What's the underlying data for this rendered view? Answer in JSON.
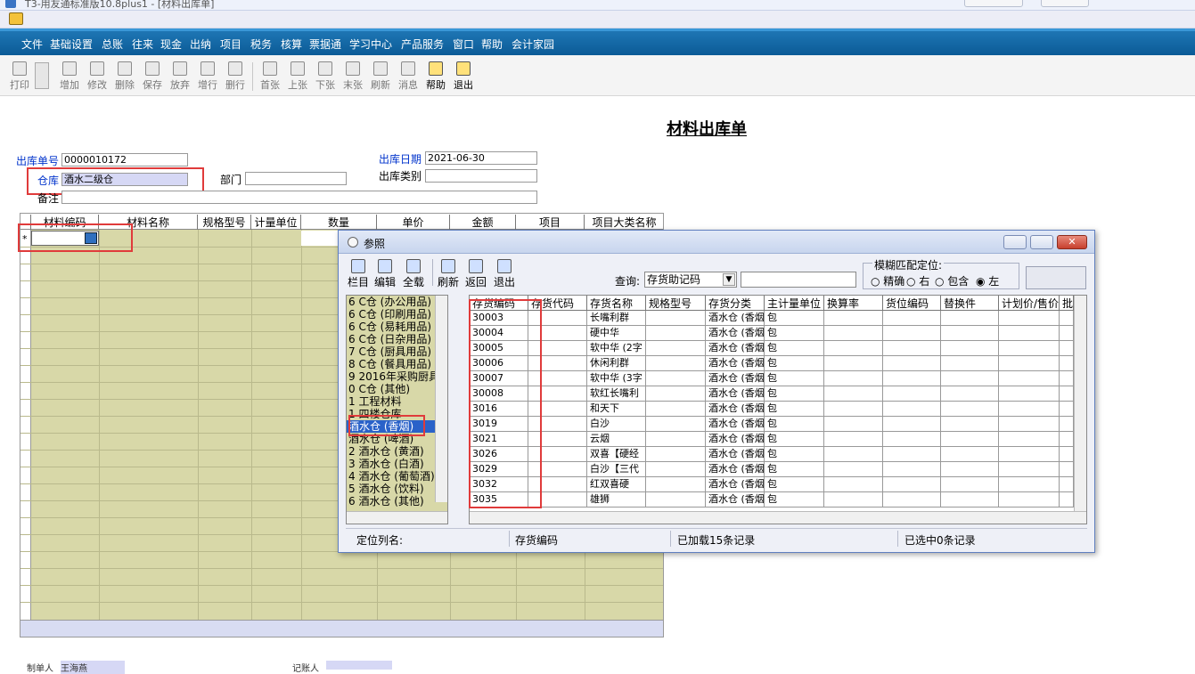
{
  "window": {
    "title": "T3-用友通标准版10.8plus1 - [材料出库单]"
  },
  "menu": [
    "文件",
    "基础设置",
    "总账",
    "往来",
    "现金",
    "出纳",
    "项目",
    "税务",
    "核算",
    "票据通",
    "学习中心",
    "产品服务",
    "窗口",
    "帮助",
    "会计家园"
  ],
  "toolbar": [
    {
      "label": "打印",
      "icon": "printer-icon",
      "active": false
    },
    {
      "label": "增加",
      "icon": "add-icon",
      "active": false
    },
    {
      "label": "修改",
      "icon": "edit-icon",
      "active": false
    },
    {
      "label": "删除",
      "icon": "delete-icon",
      "active": false
    },
    {
      "label": "保存",
      "icon": "save-icon",
      "active": false
    },
    {
      "label": "放弃",
      "icon": "discard-icon",
      "active": false
    },
    {
      "label": "增行",
      "icon": "add-row-icon",
      "active": false
    },
    {
      "label": "删行",
      "icon": "delete-row-icon",
      "active": false
    },
    {
      "label": "首张",
      "icon": "first-icon",
      "active": false
    },
    {
      "label": "上张",
      "icon": "prev-icon",
      "active": false
    },
    {
      "label": "下张",
      "icon": "next-icon",
      "active": false
    },
    {
      "label": "末张",
      "icon": "last-icon",
      "active": false
    },
    {
      "label": "刷新",
      "icon": "refresh-icon",
      "active": false
    },
    {
      "label": "消息",
      "icon": "message-icon",
      "active": false
    },
    {
      "label": "帮助",
      "icon": "help-icon",
      "active": true
    },
    {
      "label": "退出",
      "icon": "exit-icon",
      "active": true
    }
  ],
  "form": {
    "title": "材料出库单",
    "order_no_label": "出库单号",
    "order_no": "0000010172",
    "date_label": "出库日期",
    "date": "2021-06-30",
    "warehouse_label": "仓库",
    "warehouse": "酒水二级仓",
    "dept_label": "部门",
    "dept": "",
    "type_label": "出库类别",
    "type": "",
    "remark_label": "备注",
    "remark": ""
  },
  "grid": {
    "columns": [
      "材料编码",
      "材料名称",
      "规格型号",
      "计量单位",
      "数量",
      "单价",
      "金额",
      "项目",
      "项目大类名称"
    ],
    "row_marker": "*"
  },
  "dialog": {
    "title": "参照",
    "tools": [
      "栏目",
      "编辑",
      "全载",
      "刷新",
      "返回",
      "退出"
    ],
    "query_label": "查询:",
    "query_field": "存货助记码",
    "query_value": "",
    "fuzzy_label": "模糊匹配定位:",
    "fuzzy_options": [
      "精确",
      "右",
      "包含",
      "左"
    ],
    "fuzzy_selected": "左",
    "tree": [
      "6 C仓 (办公用品)",
      "6 C仓 (印刷用品)",
      "6 C仓 (易耗用品)",
      "6 C仓 (日杂用品)",
      "7 C仓 (厨具用品)",
      "8 C仓 (餐具用品)",
      "9 2016年采购厨具",
      "0 C仓 (其他)",
      "1 工程材料",
      "1 四楼仓库",
      "酒水仓 (香烟)",
      "酒水仓 (啤酒)",
      "2 酒水仓 (黄酒)",
      "3 酒水仓 (白酒)",
      "4 酒水仓 (葡萄酒)",
      "5 酒水仓 (饮料)",
      "6 酒水仓 (其他)"
    ],
    "tree_selected": 10,
    "columns": [
      "存货编码",
      "存货代码",
      "存货名称",
      "规格型号",
      "存货分类",
      "主计量单位",
      "换算率",
      "货位编码",
      "替换件",
      "计划价/售价",
      "批"
    ],
    "rows": [
      {
        "code": "30003",
        "name": "长嘴利群",
        "cat": "酒水仓 (香烟",
        "unit": "包"
      },
      {
        "code": "30004",
        "name": "硬中华",
        "cat": "酒水仓 (香烟",
        "unit": "包"
      },
      {
        "code": "30005",
        "name": "软中华 (2字",
        "cat": "酒水仓 (香烟",
        "unit": "包"
      },
      {
        "code": "30006",
        "name": "休闲利群",
        "cat": "酒水仓 (香烟",
        "unit": "包"
      },
      {
        "code": "30007",
        "name": "软中华 (3字",
        "cat": "酒水仓 (香烟",
        "unit": "包"
      },
      {
        "code": "30008",
        "name": "软红长嘴利",
        "cat": "酒水仓 (香烟",
        "unit": "包"
      },
      {
        "code": "3016",
        "name": "和天下",
        "cat": "酒水仓 (香烟",
        "unit": "包"
      },
      {
        "code": "3019",
        "name": "白沙",
        "cat": "酒水仓 (香烟",
        "unit": "包"
      },
      {
        "code": "3021",
        "name": "云烟",
        "cat": "酒水仓 (香烟",
        "unit": "包"
      },
      {
        "code": "3026",
        "name": "双喜【硬经",
        "cat": "酒水仓 (香烟",
        "unit": "包"
      },
      {
        "code": "3029",
        "name": "白沙【三代",
        "cat": "酒水仓 (香烟",
        "unit": "包"
      },
      {
        "code": "3032",
        "name": "红双喜硬",
        "cat": "酒水仓 (香烟",
        "unit": "包"
      },
      {
        "code": "3035",
        "name": "雄狮",
        "cat": "酒水仓 (香烟",
        "unit": "包"
      }
    ],
    "status": {
      "locate_label": "定位列名:",
      "locate_value": "存货编码",
      "loaded": "已加载15条记录",
      "selected": "已选中0条记录"
    }
  },
  "footer": {
    "maker_label": "制单人",
    "maker": "王海燕",
    "book_label": "记账人"
  }
}
